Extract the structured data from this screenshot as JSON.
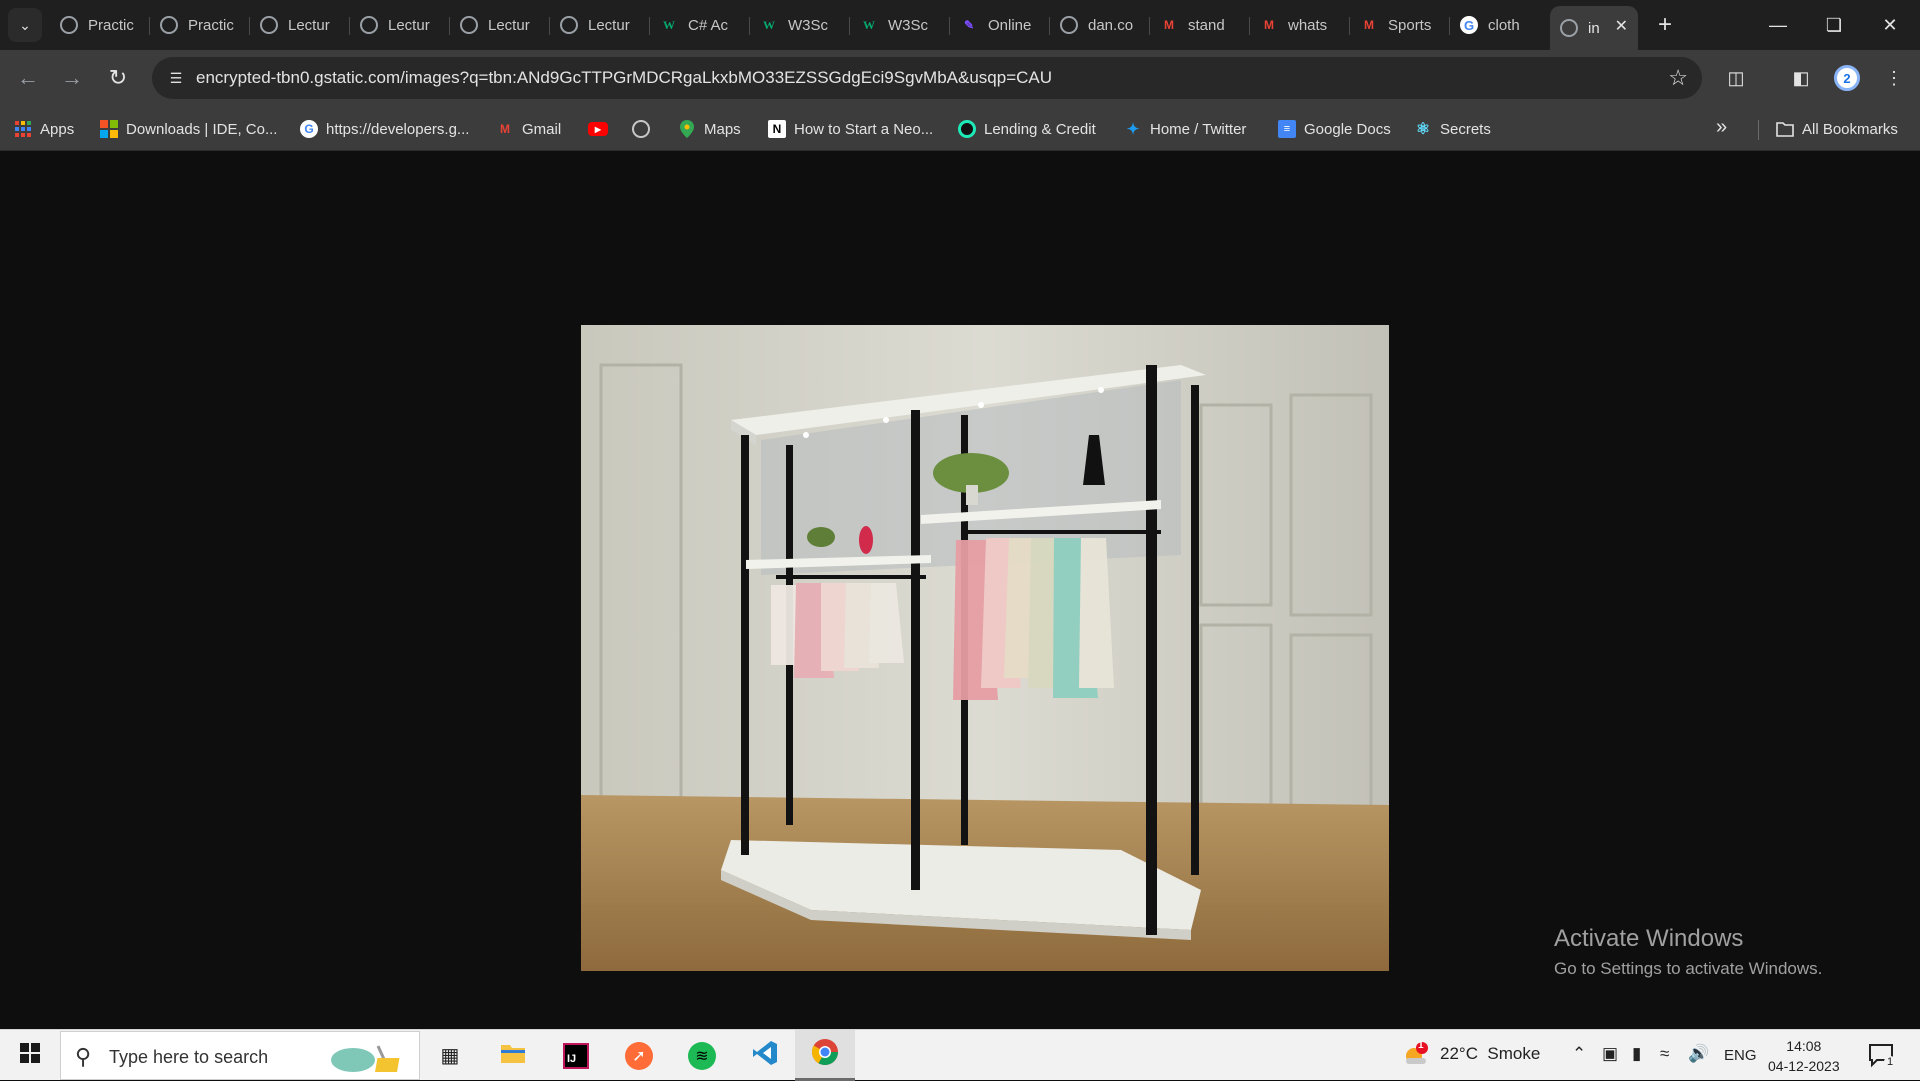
{
  "browser": {
    "tabs": [
      {
        "label": "Practic",
        "icon": "globe-icon"
      },
      {
        "label": "Practic",
        "icon": "globe-icon"
      },
      {
        "label": "Lectur",
        "icon": "globe-icon"
      },
      {
        "label": "Lectur",
        "icon": "globe-icon"
      },
      {
        "label": "Lectur",
        "icon": "globe-icon"
      },
      {
        "label": "Lectur",
        "icon": "globe-icon"
      },
      {
        "label": "C# Ac",
        "icon": "w3schools-icon"
      },
      {
        "label": "W3Sc",
        "icon": "w3schools-icon"
      },
      {
        "label": "W3Sc",
        "icon": "w3schools-icon"
      },
      {
        "label": "Online",
        "icon": "pen-icon"
      },
      {
        "label": "dan.co",
        "icon": "globe-icon"
      },
      {
        "label": "stand",
        "icon": "gmail-icon"
      },
      {
        "label": "whats",
        "icon": "gmail-icon"
      },
      {
        "label": "Sports",
        "icon": "gmail-icon"
      },
      {
        "label": "cloth",
        "icon": "google-icon"
      },
      {
        "label": "in",
        "icon": "globe-icon",
        "active": true
      }
    ],
    "url": "encrypted-tbn0.gstatic.com/images?q=tbn:ANd9GcTTPGrMDCRgaLkxbMO33EZSSGdgEci9SgvMbA&usqp=CAU",
    "profile_initial": "2",
    "bookmarks": [
      {
        "label": "Apps",
        "icon": "apps-grid-icon"
      },
      {
        "label": "Downloads | IDE, Co...",
        "icon": "windows-logo-icon"
      },
      {
        "label": "https://developers.g...",
        "icon": "google-icon"
      },
      {
        "label": "Gmail",
        "icon": "gmail-icon"
      },
      {
        "label": "",
        "icon": "youtube-icon"
      },
      {
        "label": "",
        "icon": "globe-icon"
      },
      {
        "label": "Maps",
        "icon": "maps-pin-icon"
      },
      {
        "label": "How to Start a Neo...",
        "icon": "notion-icon"
      },
      {
        "label": "Lending & Credit",
        "icon": "circle-logo-icon"
      },
      {
        "label": "Home / Twitter",
        "icon": "twitter-icon"
      },
      {
        "label": "Google Docs",
        "icon": "docs-icon"
      },
      {
        "label": "Secrets",
        "icon": "react-icon"
      }
    ],
    "all_bookmarks_label": "All Bookmarks"
  },
  "watermark": {
    "title": "Activate Windows",
    "subtitle": "Go to Settings to activate Windows."
  },
  "taskbar": {
    "search_placeholder": "Type here to search",
    "weather": "22°C  Smoke",
    "weather_badge": "1",
    "language": "ENG",
    "time": "14:08",
    "date": "04-12-2023",
    "notification_count": "1"
  }
}
